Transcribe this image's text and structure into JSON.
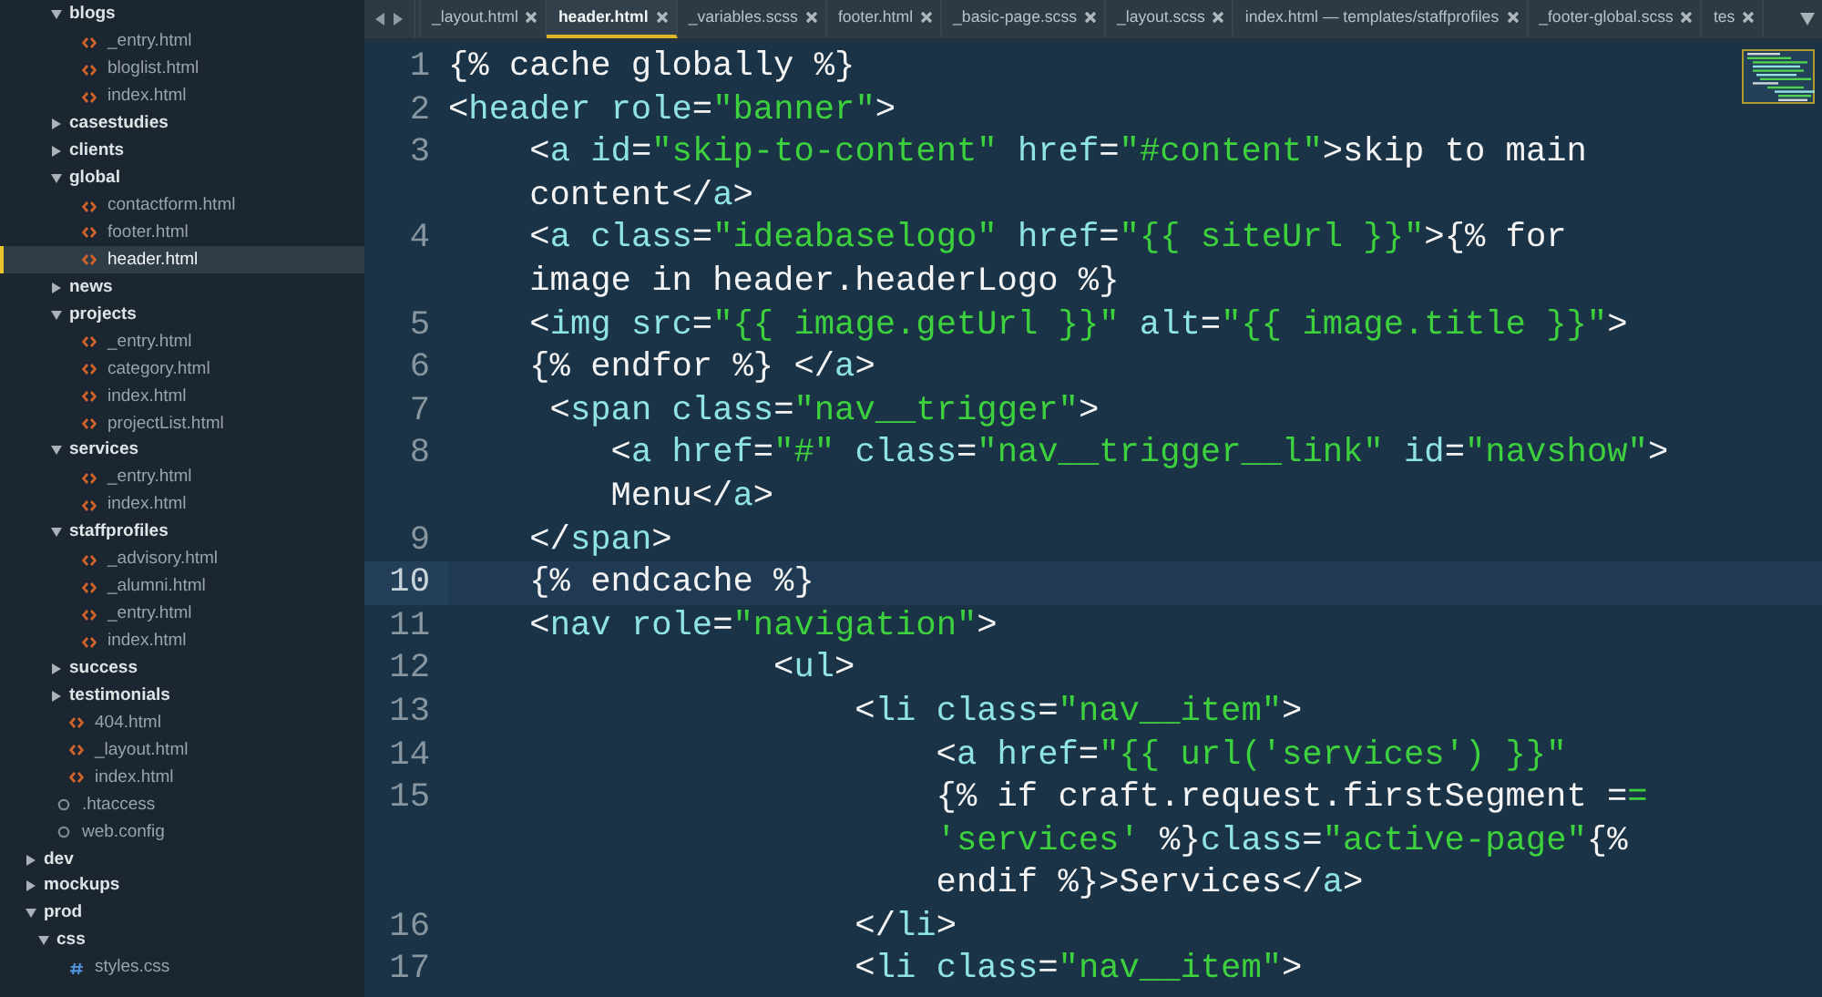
{
  "sidebar": {
    "tree": [
      {
        "children": [
          {
            "children": [
              {
                "kind": "folder",
                "label": "blogs",
                "expanded": true,
                "children": [
                  {
                    "kind": "html",
                    "label": "_entry.html",
                    "selected": false
                  },
                  {
                    "kind": "html",
                    "label": "bloglist.html",
                    "selected": false
                  },
                  {
                    "kind": "html",
                    "label": "index.html",
                    "selected": false
                  }
                ]
              },
              {
                "kind": "folder",
                "label": "casestudies",
                "expanded": false
              },
              {
                "kind": "folder",
                "label": "clients",
                "expanded": false
              },
              {
                "kind": "folder",
                "label": "global",
                "expanded": true,
                "children": [
                  {
                    "kind": "html",
                    "label": "contactform.html",
                    "selected": false
                  },
                  {
                    "kind": "html",
                    "label": "footer.html",
                    "selected": false
                  },
                  {
                    "kind": "html",
                    "label": "header.html",
                    "selected": true
                  }
                ]
              },
              {
                "kind": "folder",
                "label": "news",
                "expanded": false
              },
              {
                "kind": "folder",
                "label": "projects",
                "expanded": true,
                "children": [
                  {
                    "kind": "html",
                    "label": "_entry.html",
                    "selected": false
                  },
                  {
                    "kind": "html",
                    "label": "category.html",
                    "selected": false
                  },
                  {
                    "kind": "html",
                    "label": "index.html",
                    "selected": false
                  },
                  {
                    "kind": "html",
                    "label": "projectList.html",
                    "selected": false
                  }
                ]
              },
              {
                "kind": "folder",
                "label": "services",
                "expanded": true,
                "children": [
                  {
                    "kind": "html",
                    "label": "_entry.html",
                    "selected": false
                  },
                  {
                    "kind": "html",
                    "label": "index.html",
                    "selected": false
                  }
                ]
              },
              {
                "kind": "folder",
                "label": "staffprofiles",
                "expanded": true,
                "children": [
                  {
                    "kind": "html",
                    "label": "_advisory.html",
                    "selected": false
                  },
                  {
                    "kind": "html",
                    "label": "_alumni.html",
                    "selected": false
                  },
                  {
                    "kind": "html",
                    "label": "_entry.html",
                    "selected": false
                  },
                  {
                    "kind": "html",
                    "label": "index.html",
                    "selected": false
                  }
                ]
              },
              {
                "kind": "folder",
                "label": "success",
                "expanded": false
              },
              {
                "kind": "folder",
                "label": "testimonials",
                "expanded": false
              },
              {
                "kind": "html",
                "label": "404.html",
                "selected": false
              },
              {
                "kind": "html",
                "label": "_layout.html",
                "selected": false
              },
              {
                "kind": "html",
                "label": "index.html",
                "selected": false
              }
            ]
          },
          {
            "kind": "config",
            "label": ".htaccess",
            "selected": false
          },
          {
            "kind": "config",
            "label": "web.config",
            "selected": false
          }
        ]
      },
      {
        "kind": "folder",
        "label": "dev",
        "expanded": false
      },
      {
        "kind": "folder",
        "label": "mockups",
        "expanded": false
      },
      {
        "kind": "folder",
        "label": "prod",
        "expanded": true,
        "children": [
          {
            "kind": "folder",
            "label": "css",
            "expanded": true,
            "children": [
              {
                "kind": "css",
                "label": "styles.css",
                "selected": false
              }
            ]
          }
        ]
      }
    ]
  },
  "tabs": [
    {
      "label": "_layout.html",
      "selected": false
    },
    {
      "label": "header.html",
      "selected": true
    },
    {
      "label": "_variables.scss",
      "selected": false
    },
    {
      "label": "footer.html",
      "selected": false
    },
    {
      "label": "_basic-page.scss",
      "selected": false
    },
    {
      "label": "_layout.scss",
      "selected": false
    },
    {
      "label": "index.html — templates/staffprofiles",
      "selected": false
    },
    {
      "label": "_footer-global.scss",
      "selected": false
    },
    {
      "label": "tes",
      "selected": false
    }
  ],
  "code": [
    {
      "number": "1",
      "selected": false,
      "rows": [
        {
          "indent": "",
          "tokens": [
            {
              "kind": "plain",
              "text": "{% cache globally %}"
            }
          ]
        }
      ]
    },
    {
      "number": "2",
      "selected": false,
      "rows": [
        {
          "indent": "",
          "tokens": [
            {
              "kind": "plain",
              "text": "<"
            },
            {
              "kind": "name",
              "text": "header role"
            },
            {
              "kind": "plain",
              "text": "="
            },
            {
              "kind": "string",
              "text": "\"banner\""
            },
            {
              "kind": "plain",
              "text": ">"
            }
          ]
        }
      ]
    },
    {
      "number": "3",
      "selected": false,
      "rows": [
        {
          "indent": "    ",
          "tokens": [
            {
              "kind": "plain",
              "text": "<"
            },
            {
              "kind": "name",
              "text": "a id"
            },
            {
              "kind": "plain",
              "text": "="
            },
            {
              "kind": "string",
              "text": "\"skip-to-content\""
            },
            {
              "kind": "name",
              "text": " href"
            },
            {
              "kind": "plain",
              "text": "="
            },
            {
              "kind": "string",
              "text": "\"#content\""
            },
            {
              "kind": "plain",
              "text": ">skip to main"
            }
          ]
        },
        {
          "indent": "    ",
          "tokens": [
            {
              "kind": "plain",
              "text": "content</"
            },
            {
              "kind": "name",
              "text": "a"
            },
            {
              "kind": "plain",
              "text": ">"
            }
          ]
        }
      ]
    },
    {
      "number": "4",
      "selected": false,
      "rows": [
        {
          "indent": "    ",
          "tokens": [
            {
              "kind": "plain",
              "text": "<"
            },
            {
              "kind": "name",
              "text": "a class"
            },
            {
              "kind": "plain",
              "text": "="
            },
            {
              "kind": "string",
              "text": "\"ideabaselogo\""
            },
            {
              "kind": "name",
              "text": " href"
            },
            {
              "kind": "plain",
              "text": "="
            },
            {
              "kind": "string",
              "text": "\"{{ siteUrl }}\""
            },
            {
              "kind": "plain",
              "text": ">{% for"
            }
          ]
        },
        {
          "indent": "    ",
          "tokens": [
            {
              "kind": "plain",
              "text": "image in header.headerLogo %}"
            }
          ]
        }
      ]
    },
    {
      "number": "5",
      "selected": false,
      "rows": [
        {
          "indent": "    ",
          "tokens": [
            {
              "kind": "plain",
              "text": "<"
            },
            {
              "kind": "name",
              "text": "img src"
            },
            {
              "kind": "plain",
              "text": "="
            },
            {
              "kind": "string",
              "text": "\"{{ image.getUrl }}\""
            },
            {
              "kind": "name",
              "text": " alt"
            },
            {
              "kind": "plain",
              "text": "="
            },
            {
              "kind": "string",
              "text": "\"{{ image.title }}\""
            },
            {
              "kind": "plain",
              "text": ">"
            }
          ]
        }
      ]
    },
    {
      "number": "6",
      "selected": false,
      "rows": [
        {
          "indent": "    ",
          "tokens": [
            {
              "kind": "plain",
              "text": "{% endfor %} </"
            },
            {
              "kind": "name",
              "text": "a"
            },
            {
              "kind": "plain",
              "text": ">"
            }
          ]
        }
      ]
    },
    {
      "number": "7",
      "selected": false,
      "rows": [
        {
          "indent": "     ",
          "tokens": [
            {
              "kind": "plain",
              "text": "<"
            },
            {
              "kind": "name",
              "text": "span class"
            },
            {
              "kind": "plain",
              "text": "="
            },
            {
              "kind": "string",
              "text": "\"nav__trigger\""
            },
            {
              "kind": "plain",
              "text": ">"
            }
          ]
        }
      ]
    },
    {
      "number": "8",
      "selected": false,
      "rows": [
        {
          "indent": "        ",
          "tokens": [
            {
              "kind": "plain",
              "text": "<"
            },
            {
              "kind": "name",
              "text": "a href"
            },
            {
              "kind": "plain",
              "text": "="
            },
            {
              "kind": "string",
              "text": "\"#\""
            },
            {
              "kind": "name",
              "text": " class"
            },
            {
              "kind": "plain",
              "text": "="
            },
            {
              "kind": "string",
              "text": "\"nav__trigger__link\""
            },
            {
              "kind": "name",
              "text": " id"
            },
            {
              "kind": "plain",
              "text": "="
            },
            {
              "kind": "string",
              "text": "\"navshow\""
            },
            {
              "kind": "plain",
              "text": ">"
            }
          ]
        },
        {
          "indent": "        ",
          "tokens": [
            {
              "kind": "plain",
              "text": "Menu</"
            },
            {
              "kind": "name",
              "text": "a"
            },
            {
              "kind": "plain",
              "text": ">"
            }
          ]
        }
      ]
    },
    {
      "number": "9",
      "selected": false,
      "rows": [
        {
          "indent": "    ",
          "tokens": [
            {
              "kind": "plain",
              "text": "</"
            },
            {
              "kind": "name",
              "text": "span"
            },
            {
              "kind": "plain",
              "text": ">"
            }
          ]
        }
      ]
    },
    {
      "number": "10",
      "selected": true,
      "rows": [
        {
          "indent": "    ",
          "tokens": [
            {
              "kind": "plain",
              "text": "{% endcache %}"
            }
          ]
        }
      ]
    },
    {
      "number": "11",
      "selected": false,
      "rows": [
        {
          "indent": "    ",
          "tokens": [
            {
              "kind": "plain",
              "text": "<"
            },
            {
              "kind": "name",
              "text": "nav role"
            },
            {
              "kind": "plain",
              "text": "="
            },
            {
              "kind": "string",
              "text": "\"navigation\""
            },
            {
              "kind": "plain",
              "text": ">"
            }
          ]
        }
      ]
    },
    {
      "number": "12",
      "selected": false,
      "rows": [
        {
          "indent": "                ",
          "tokens": [
            {
              "kind": "plain",
              "text": "<"
            },
            {
              "kind": "name",
              "text": "ul"
            },
            {
              "kind": "plain",
              "text": ">"
            }
          ]
        }
      ]
    },
    {
      "number": "13",
      "selected": false,
      "rows": [
        {
          "indent": "                    ",
          "tokens": [
            {
              "kind": "plain",
              "text": "<"
            },
            {
              "kind": "name",
              "text": "li class"
            },
            {
              "kind": "plain",
              "text": "="
            },
            {
              "kind": "string",
              "text": "\"nav__item\""
            },
            {
              "kind": "plain",
              "text": ">"
            }
          ]
        }
      ]
    },
    {
      "number": "14",
      "selected": false,
      "rows": [
        {
          "indent": "                        ",
          "tokens": [
            {
              "kind": "plain",
              "text": "<"
            },
            {
              "kind": "name",
              "text": "a href"
            },
            {
              "kind": "plain",
              "text": "="
            },
            {
              "kind": "string",
              "text": "\"{{ url('services') }}\""
            }
          ]
        }
      ]
    },
    {
      "number": "15",
      "selected": false,
      "rows": [
        {
          "indent": "                        ",
          "tokens": [
            {
              "kind": "plain",
              "text": "{% if craft.request.firstSegment ="
            },
            {
              "kind": "string",
              "text": "="
            }
          ]
        },
        {
          "indent": "                        ",
          "tokens": [
            {
              "kind": "string",
              "text": "'services'"
            },
            {
              "kind": "plain",
              "text": " %}"
            },
            {
              "kind": "name",
              "text": "class"
            },
            {
              "kind": "plain",
              "text": "="
            },
            {
              "kind": "string",
              "text": "\"active-page\""
            },
            {
              "kind": "plain",
              "text": "{%"
            }
          ]
        },
        {
          "indent": "                        ",
          "tokens": [
            {
              "kind": "plain",
              "text": "endif %}>Services</"
            },
            {
              "kind": "name",
              "text": "a"
            },
            {
              "kind": "plain",
              "text": ">"
            }
          ]
        }
      ]
    },
    {
      "number": "16",
      "selected": false,
      "rows": [
        {
          "indent": "                    ",
          "tokens": [
            {
              "kind": "plain",
              "text": "</"
            },
            {
              "kind": "name",
              "text": "li"
            },
            {
              "kind": "plain",
              "text": ">"
            }
          ]
        }
      ]
    },
    {
      "number": "17",
      "selected": false,
      "rows": [
        {
          "indent": "                    ",
          "tokens": [
            {
              "kind": "plain",
              "text": "<"
            },
            {
              "kind": "name",
              "text": "li class"
            },
            {
              "kind": "plain",
              "text": "="
            },
            {
              "kind": "string",
              "text": "\"nav__item\""
            },
            {
              "kind": "plain",
              "text": ">"
            }
          ]
        }
      ]
    }
  ]
}
